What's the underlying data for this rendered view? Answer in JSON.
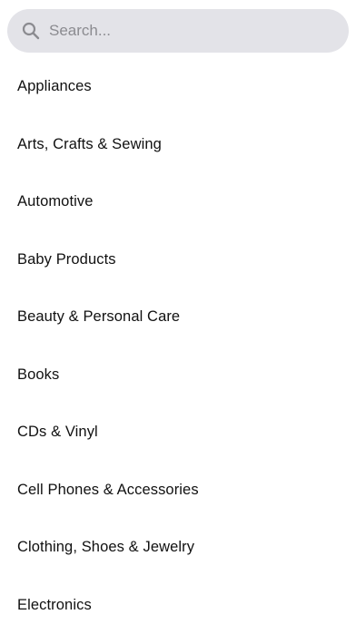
{
  "search": {
    "placeholder": "Search...",
    "value": "",
    "icon": "search-icon"
  },
  "categories": [
    "Appliances",
    "Arts, Crafts & Sewing",
    "Automotive",
    "Baby Products",
    "Beauty & Personal Care",
    "Books",
    "CDs & Vinyl",
    "Cell Phones & Accessories",
    "Clothing, Shoes & Jewelry",
    "Electronics"
  ],
  "colors": {
    "search_background": "#e3e3e8",
    "placeholder": "#8b8b90",
    "text": "#111111"
  }
}
